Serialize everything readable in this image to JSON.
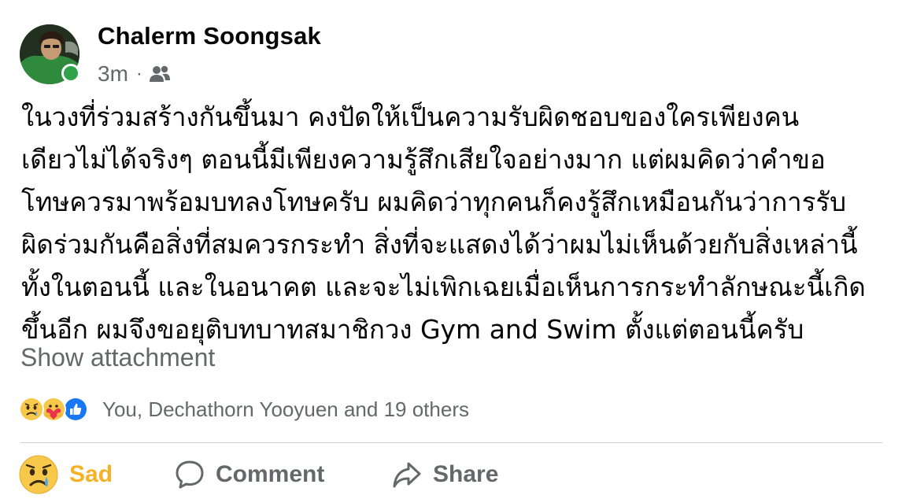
{
  "post": {
    "author": "Chalerm Soongsak",
    "time": "3m",
    "separator": "·",
    "audience_icon": "friends-icon",
    "text_lines": [
      "ในวงที่ร่วมสร้างกันขึ้นมา คงปัดให้เป็นความรับผิดชอบของใครเพียงคน",
      "เดียวไม่ได้จริงๆ ตอนนี้มีเพียงความรู้สึกเสียใจอย่างมาก แต่ผมคิดว่าคำขอ",
      "โทษควรมาพร้อมบทลงโทษครับ ผมคิดว่าทุกคนก็คงรู้สึกเหมือนกันว่าการรับ",
      "ผิดร่วมกันคือสิ่งที่สมควรกระทำ สิ่งที่จะแสดงได้ว่าผมไม่เห็นด้วยกับสิ่งเหล่านี้",
      "ทั้งในตอนนี้ และในอนาคต และจะไม่เพิกเฉยเมื่อเห็นการกระทำลักษณะนี้เกิด",
      "ขึ้นอีก ผมจึงขอยุติบทบาทสมาชิกวง Gym and Swim ตั้งแต่ตอนนี้ครับ"
    ],
    "show_attachment": "Show attachment"
  },
  "reactions": {
    "icons": [
      "sad-reaction-icon",
      "care-reaction-icon",
      "like-reaction-icon"
    ],
    "summary": "You, Dechathorn Yooyuen and 19 others"
  },
  "actions": {
    "sad_label": "Sad",
    "comment_label": "Comment",
    "share_label": "Share"
  },
  "colors": {
    "secondary_text": "#65676b",
    "sad_active": "#f7b125",
    "like_blue": "#1877f2",
    "online_green": "#31a24c"
  }
}
